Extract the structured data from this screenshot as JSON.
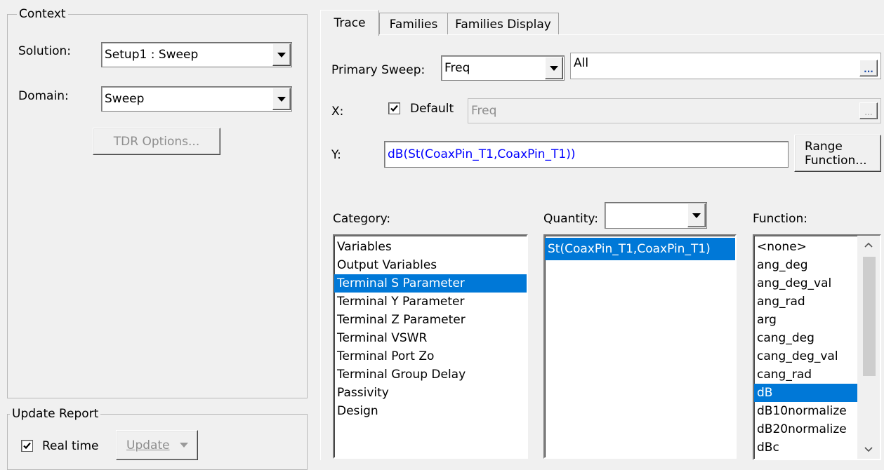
{
  "context": {
    "legend": "Context",
    "solution_label": "Solution:",
    "solution_value": "Setup1 : Sweep",
    "domain_label": "Domain:",
    "domain_value": "Sweep",
    "tdr_button": "TDR Options..."
  },
  "update_report": {
    "legend": "Update Report",
    "realtime_label": "Real time",
    "realtime_checked": true,
    "update_button": "Update"
  },
  "tabs": [
    {
      "label": "Trace",
      "active": true
    },
    {
      "label": "Families",
      "active": false
    },
    {
      "label": "Families Display",
      "active": false
    }
  ],
  "trace": {
    "primary_sweep_label": "Primary Sweep:",
    "primary_sweep_value": "Freq",
    "primary_sweep_range": "All",
    "ellipsis": "...",
    "x_label": "X:",
    "x_default_label": "Default",
    "x_default_checked": true,
    "x_value": "Freq",
    "y_label": "Y:",
    "y_value": "dB(St(CoaxPin_T1,CoaxPin_T1))",
    "range_function_button": "Range Function...",
    "category_label": "Category:",
    "quantity_label": "Quantity:",
    "quantity_filter_value": "",
    "function_label": "Function:",
    "categories": [
      "Variables",
      "Output Variables",
      "Terminal S Parameter",
      "Terminal Y Parameter",
      "Terminal Z Parameter",
      "Terminal VSWR",
      "Terminal Port Zo",
      "Terminal Group Delay",
      "Passivity",
      "Design"
    ],
    "selected_category": "Terminal S Parameter",
    "quantities": [
      "St(CoaxPin_T1,CoaxPin_T1)"
    ],
    "selected_quantity": "St(CoaxPin_T1,CoaxPin_T1)",
    "functions": [
      "<none>",
      "ang_deg",
      "ang_deg_val",
      "ang_rad",
      "arg",
      "cang_deg",
      "cang_deg_val",
      "cang_rad",
      "dB",
      "dB10normalize",
      "dB20normalize",
      "dBc"
    ],
    "selected_function": "dB"
  },
  "colors": {
    "selection_bg": "#0078d7",
    "y_text": "#0000ff",
    "quantity_text": "#0000ff"
  }
}
